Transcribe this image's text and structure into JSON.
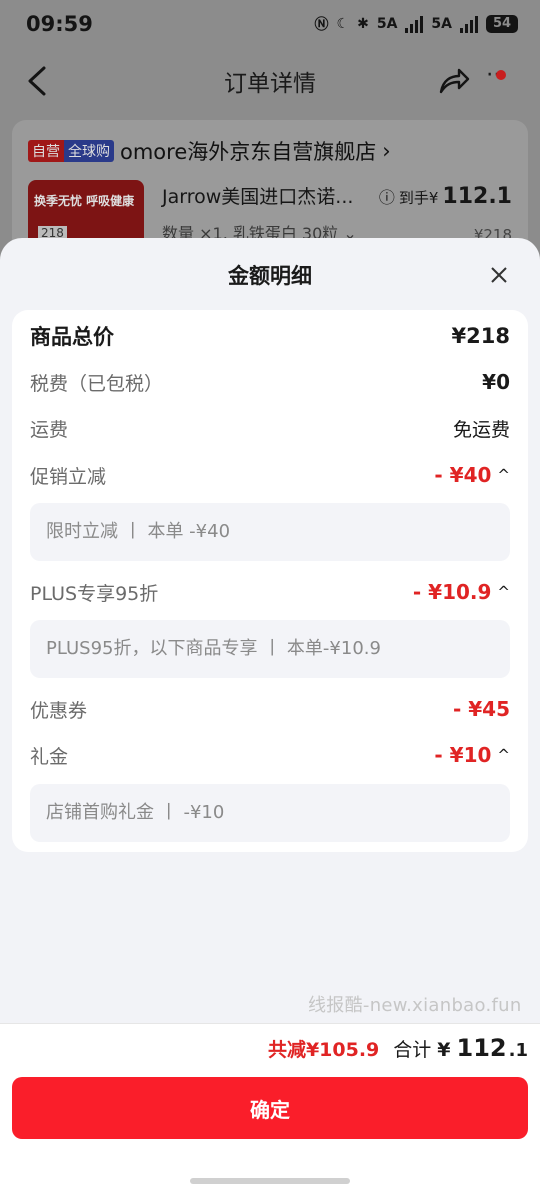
{
  "status_bar": {
    "time": "09:59",
    "net1": "5A",
    "net2": "5A",
    "battery": "54"
  },
  "nav": {
    "title": "订单详情",
    "more": "⋯"
  },
  "order": {
    "tag_self": "自营",
    "tag_global": "全球购",
    "store_name": "omore海外京东自营旗舰店",
    "store_arrow": "›",
    "product_title": "Jarrow美国进口杰诺...",
    "product_spec": "数量 ×1, 乳铁蛋白 30粒 ⌄",
    "final_label": "到手¥",
    "final_price": "112.1",
    "orig_price": "¥218",
    "img_label": "换季无忧 呼吸健康",
    "img_price": "218"
  },
  "sheet": {
    "title": "金额明细",
    "rows": {
      "total": {
        "label": "商品总价",
        "value": "¥218"
      },
      "tax": {
        "label": "税费（已包税）",
        "value": "¥0"
      },
      "shipping": {
        "label": "运费",
        "value": "免运费"
      },
      "promo": {
        "label": "促销立减",
        "value": "- ¥40",
        "detail": "限时立减 丨 本单 -¥40"
      },
      "plus": {
        "label": "PLUS专享95折",
        "value": "- ¥10.9",
        "detail": "PLUS95折，以下商品专享 丨 本单-¥10.9"
      },
      "coupon": {
        "label": "优惠券",
        "value": "- ¥45"
      },
      "gift": {
        "label": "礼金",
        "value": "- ¥10",
        "detail": "店铺首购礼金 丨 -¥10"
      }
    },
    "watermark": "线报酷-new.xianbao.fun"
  },
  "footer": {
    "discount": "共减¥105.9",
    "total_label": "合计",
    "total_currency": "¥",
    "total_int": "112",
    "total_dec": ".1",
    "confirm": "确定"
  },
  "colors": {
    "accent_red": "#e02424",
    "button_red": "#fa1e2a"
  }
}
